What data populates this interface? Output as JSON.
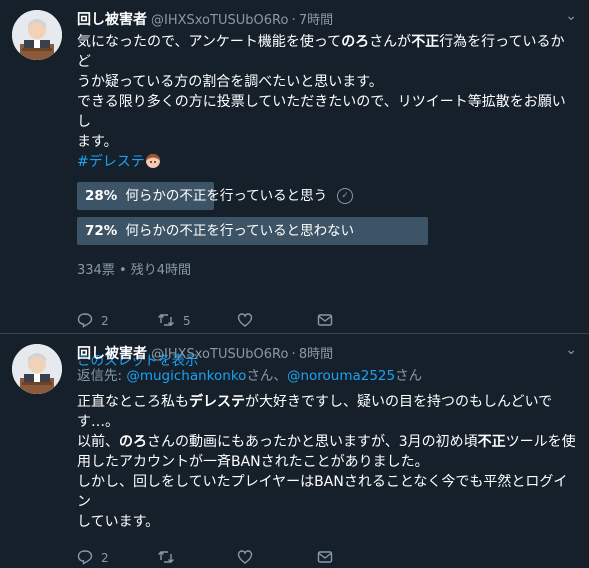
{
  "tweets": [
    {
      "name": "回し被害者",
      "handle": "@IHXSxoTUSUbO6Ro",
      "time": "7時間",
      "body_lines": [
        [
          "気になったので、アンケート機能を使って",
          "のろ",
          "さんが",
          "不正",
          "行為を行っているかど"
        ],
        "うか疑っている方の割合を調べたいと思います。",
        "できる限り多くの方に投票していただきたいので、リツイート等拡散をお願いし",
        "ます。"
      ],
      "hashtag": "#デレステ",
      "poll": {
        "options": [
          {
            "percent": "28%",
            "label": "何らかの不正を行っていると思う",
            "value": 0.28
          },
          {
            "percent": "72%",
            "label": "何らかの不正を行っていると思わない",
            "value": 0.72
          }
        ],
        "meta": "334票 • 残り4時間"
      },
      "reply_count": "2",
      "retweet_count": "5",
      "show_thread": "このスレッドを表示"
    },
    {
      "name": "回し被害者",
      "handle": "@IHXSxoTUSUbO6Ro",
      "time": "8時間",
      "replying_prefix": "返信先: ",
      "replying_user1": "@mugichankonko",
      "replying_mid": "さん、",
      "replying_user2": "@norouma2525",
      "replying_suffix": "さん",
      "reply_count": "2"
    }
  ],
  "colors": {
    "background": "#15202b",
    "secondary_text": "#8899a6",
    "link": "#1da1f2",
    "poll_bar": "#3d5466",
    "divider": "#38444d"
  }
}
